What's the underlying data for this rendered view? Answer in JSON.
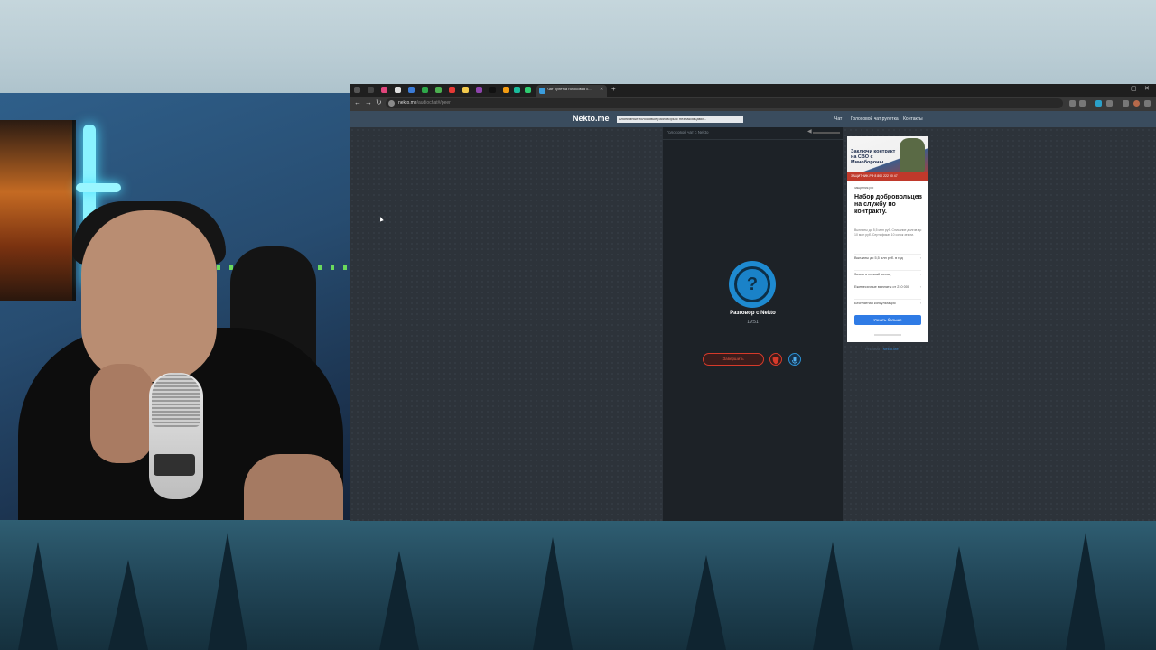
{
  "browser": {
    "tab": {
      "title": "Чат рулетка голосовая с...",
      "close": "✕"
    },
    "new_tab": "+",
    "window_controls": [
      "–",
      "▢",
      "✕"
    ],
    "nav": {
      "back": "←",
      "forward": "→",
      "reload": "↻"
    },
    "url": {
      "host": "nekto.me",
      "path": "/audiochat#/peer"
    }
  },
  "site": {
    "logo": "Nekto.me",
    "slogan": "Анонимные голосовые разговоры с незнакомцами...",
    "nav": [
      "Чат",
      "Голосовой чат рулетка",
      "Контакты"
    ]
  },
  "chat": {
    "title": "Голосовой чат с Nekto",
    "avatar_symbol": "?",
    "conversation_label": "Разговор с Nekto",
    "timer": "19:51",
    "end_button": "Завершить",
    "report_icon": "shield-icon",
    "mic_icon": "microphone-icon"
  },
  "ad": {
    "banner_text": "Заключи контракт на СВО с Минобороны",
    "banner_strip": "ЗАЩИТНИК.РФ  8 800 222 00 47",
    "domain": "защитник.рф",
    "heading": "Набор добровольцев на службу по контракту.",
    "description": "Выплаты до 5,5 млн руб. Списание долгов до 10 млн руб. Сертификат 10 соток земли.",
    "rows": [
      "Выплаты до 5,5 млн руб. в год",
      "Зачем в первый месяц",
      "Ежемесячные выплаты от 210 000",
      "Бесплатная консультация"
    ],
    "cta": "Узнать больше",
    "below": {
      "prefix": "Реклама · ",
      "link": "Nekto.Me"
    }
  }
}
